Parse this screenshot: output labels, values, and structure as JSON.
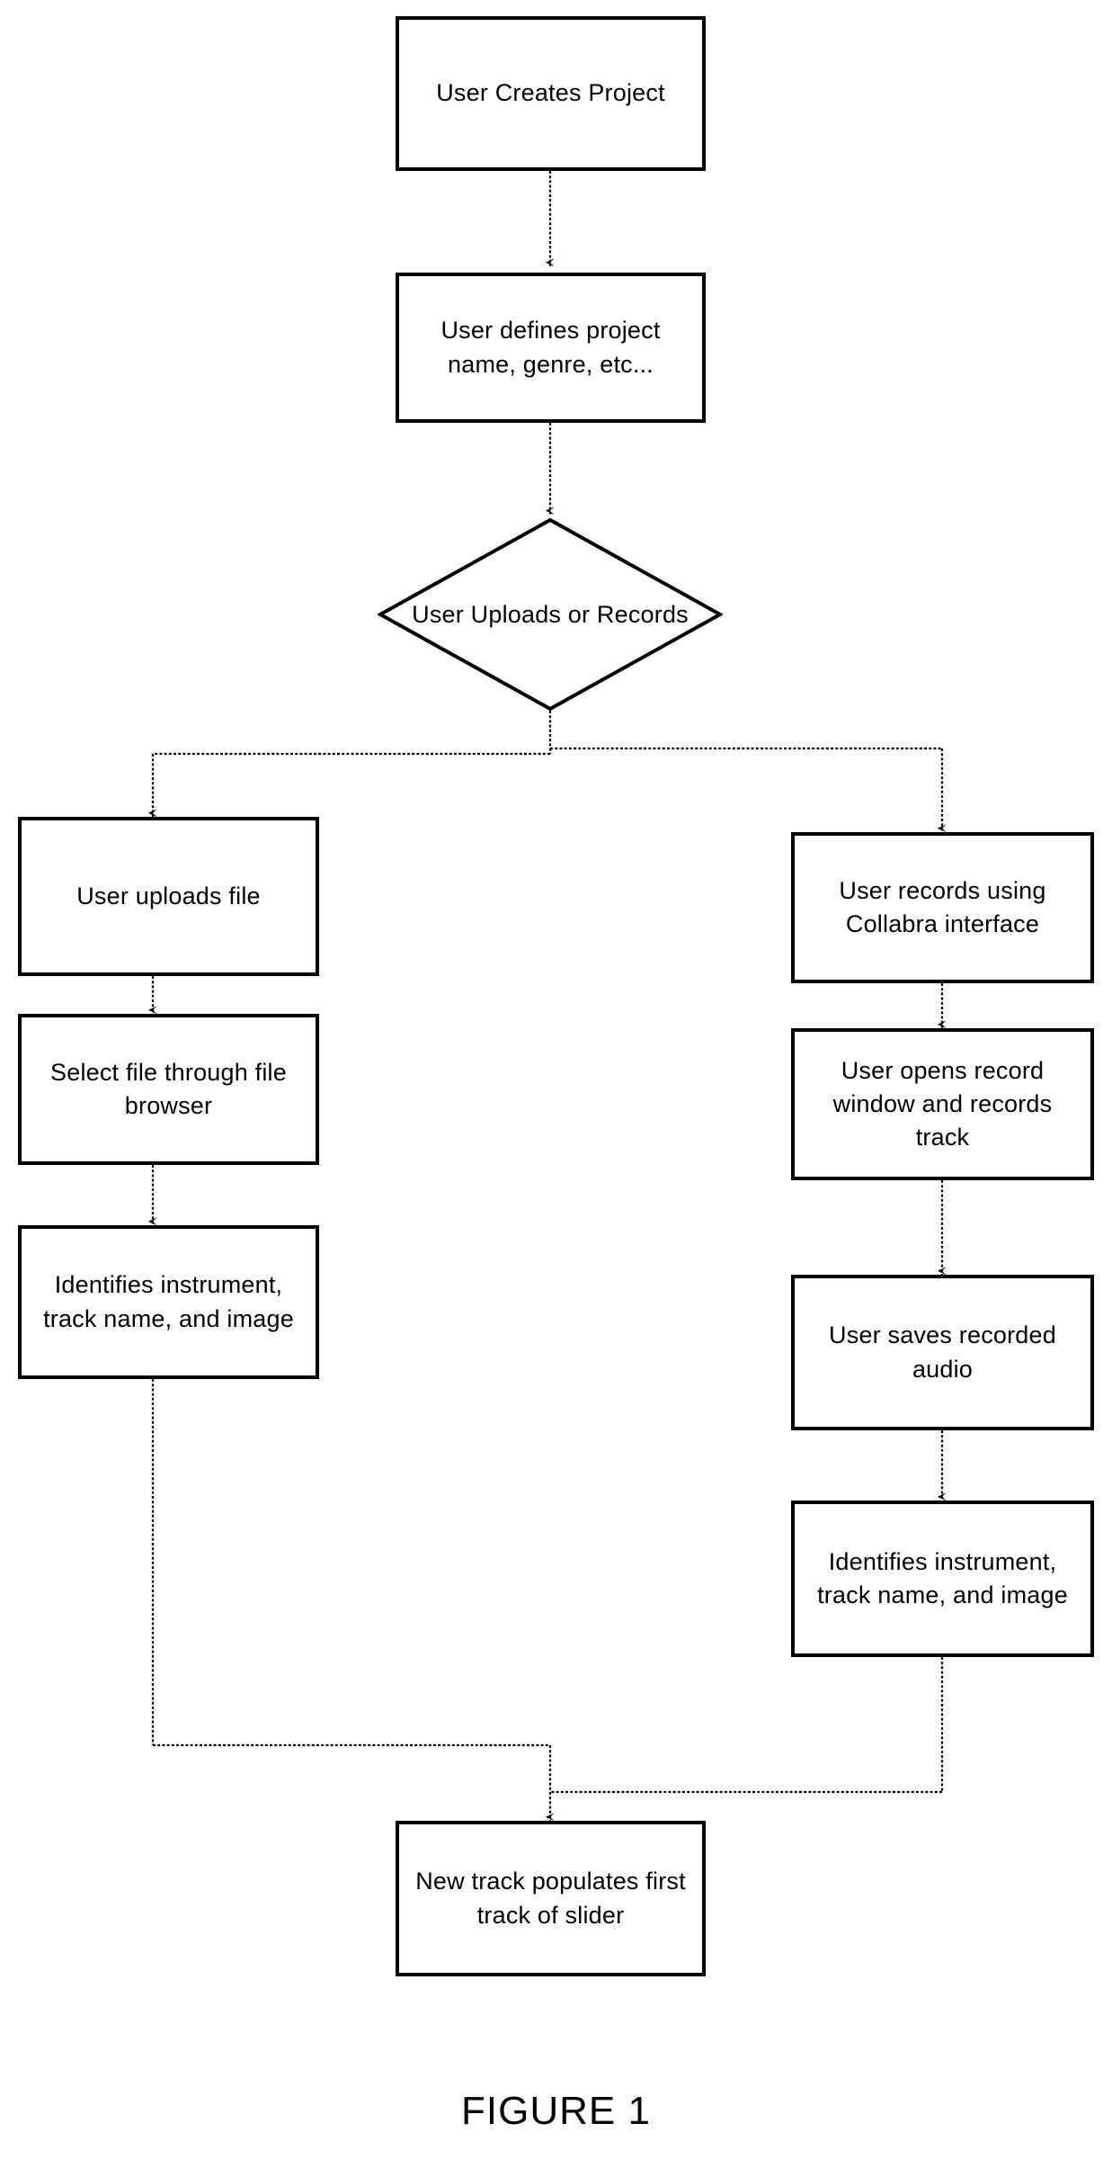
{
  "figure": {
    "caption": "FIGURE 1",
    "line_color": "#000000",
    "box_border_color": "#000000",
    "background_color": "#ffffff"
  },
  "nodes": {
    "start": {
      "label": "User Creates Project",
      "shape": "rectangle"
    },
    "define": {
      "label": "User defines project name, genre, etc...",
      "shape": "rectangle"
    },
    "decision": {
      "label": "User Uploads or Records",
      "shape": "diamond"
    },
    "upload_file": {
      "label": "User uploads file",
      "shape": "rectangle"
    },
    "select_file": {
      "label": "Select file through file browser",
      "shape": "rectangle"
    },
    "identify_left": {
      "label": "Identifies instrument, track name, and image",
      "shape": "rectangle"
    },
    "record_collabra": {
      "label": "User records using Collabra interface",
      "shape": "rectangle"
    },
    "record_window": {
      "label": "User opens record window and records track",
      "shape": "rectangle"
    },
    "save_audio": {
      "label": "User saves recorded audio",
      "shape": "rectangle"
    },
    "identify_right": {
      "label": "Identifies instrument, track name, and image",
      "shape": "rectangle"
    },
    "populate": {
      "label": "New track populates first track of slider",
      "shape": "rectangle"
    }
  },
  "edges": [
    {
      "from": "start",
      "to": "define"
    },
    {
      "from": "define",
      "to": "decision"
    },
    {
      "from": "decision",
      "to": "upload_file"
    },
    {
      "from": "decision",
      "to": "record_collabra"
    },
    {
      "from": "upload_file",
      "to": "select_file"
    },
    {
      "from": "select_file",
      "to": "identify_left"
    },
    {
      "from": "record_collabra",
      "to": "record_window"
    },
    {
      "from": "record_window",
      "to": "save_audio"
    },
    {
      "from": "save_audio",
      "to": "identify_right"
    },
    {
      "from": "identify_left",
      "to": "populate"
    },
    {
      "from": "identify_right",
      "to": "populate"
    }
  ]
}
